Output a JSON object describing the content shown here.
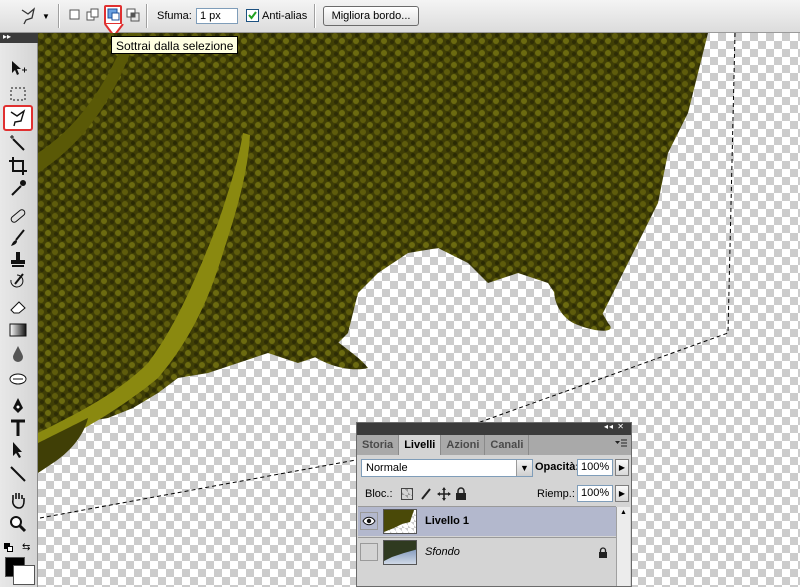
{
  "optionsbar": {
    "feather_label": "Sfuma:",
    "feather_value": "1 px",
    "antialias_label": "Anti-alias",
    "antialias_checked": true,
    "refine_edge_label": "Migliora bordo..."
  },
  "tooltip": {
    "text": "Sottrai dalla selezione"
  },
  "toolbox": {
    "tools": [
      "move-tool",
      "marquee-tool",
      "lasso-tool",
      "magic-wand-tool",
      "crop-tool",
      "eyedropper-tool",
      "healing-brush-tool",
      "brush-tool",
      "clone-stamp-tool",
      "history-brush-tool",
      "eraser-tool",
      "gradient-tool",
      "blur-tool",
      "dodge-tool",
      "pen-tool",
      "type-tool",
      "path-selection-tool",
      "line-tool",
      "hand-tool",
      "zoom-tool"
    ],
    "active_tool": "lasso-tool"
  },
  "layers_panel": {
    "tabs": [
      {
        "label": "Storia",
        "active": false
      },
      {
        "label": "Livelli",
        "active": true
      },
      {
        "label": "Azioni",
        "active": false
      },
      {
        "label": "Canali",
        "active": false
      }
    ],
    "blend_mode": "Normale",
    "opacity_label": "Opacità:",
    "opacity_value": "100%",
    "lock_label": "Bloc.:",
    "fill_label": "Riemp.:",
    "fill_value": "100%",
    "layers": [
      {
        "name": "Livello 1",
        "visible": true,
        "active": true,
        "locked": false
      },
      {
        "name": "Sfondo",
        "visible": false,
        "active": false,
        "locked": true
      }
    ]
  },
  "colors": {
    "highlight_red": "#e03030",
    "foliage_dark": "#3b3a05",
    "foliage_light": "#8a8a10",
    "layer_selected": "#b3b8cd"
  }
}
